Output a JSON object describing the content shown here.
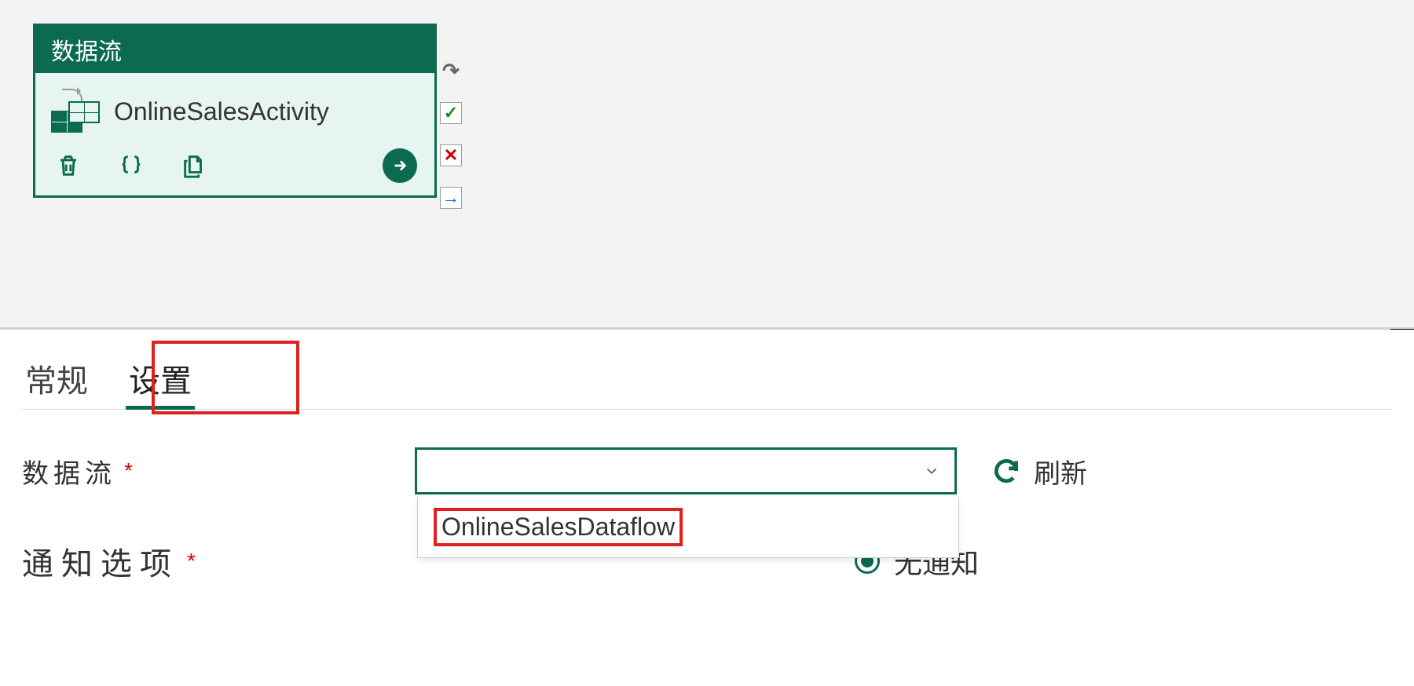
{
  "activity": {
    "header": "数据流",
    "name": "OnlineSalesActivity"
  },
  "side_icons": {
    "refresh": "↻",
    "check": "✓",
    "cross": "✕",
    "arrow": "→"
  },
  "tabs": {
    "general": "常规",
    "settings": "设置"
  },
  "form": {
    "dataflow_label": "数据流",
    "dataflow_options": [
      "OnlineSalesDataflow"
    ],
    "refresh_label": "刷新",
    "notify_label": "通知选项",
    "notify_option_none": "无通知"
  }
}
